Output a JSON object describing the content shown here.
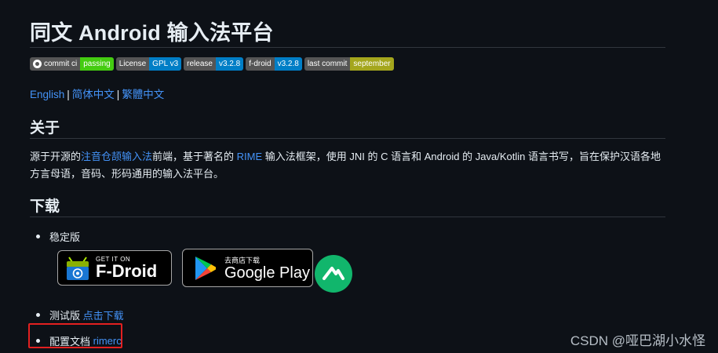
{
  "title": "同文 Android 输入法平台",
  "badges": [
    {
      "label": "commit ci",
      "value": "passing",
      "color": "#4c1",
      "icon": "github-icon"
    },
    {
      "label": "License",
      "value": "GPL v3",
      "color": "#007ec6"
    },
    {
      "label": "release",
      "value": "v3.2.8",
      "color": "#007ec6"
    },
    {
      "label": "f-droid",
      "value": "v3.2.8",
      "color": "#007ec6"
    },
    {
      "label": "last commit",
      "value": "september",
      "color": "#a4a61d"
    }
  ],
  "languages": {
    "english": "English",
    "sep": "|",
    "simplified": "简体中文",
    "traditional": "繁體中文"
  },
  "about": {
    "heading": "关于",
    "text_1": "源于开源的",
    "link_1": "注音仓颉输入法",
    "text_2": "前端，基于著名的 ",
    "link_2": "RIME",
    "text_3": " 输入法框架，使用 JNI 的 C 语言和 Android 的 Java/Kotlin 语言书写，旨在保护汉语各地方言母语，音码、形码通用的输入法平台。"
  },
  "download": {
    "heading": "下载",
    "stable": "稳定版",
    "fdroid": {
      "small": "GET IT ON",
      "big": "F-Droid",
      "icon": "fdroid-icon"
    },
    "gplay": {
      "small": "去商店下载",
      "big": "Google Play",
      "icon": "google-play-icon"
    },
    "coolapk": {
      "icon": "coolapk-icon"
    },
    "beta_label": "测试版 ",
    "beta_link": "点击下载",
    "config_label": "配置文档 ",
    "config_link": "rimerc"
  },
  "watermark": "CSDN @哑巴湖小水怪",
  "colors": {
    "background": "#0d1117",
    "link": "#4493f8",
    "highlight": "#e22020"
  }
}
